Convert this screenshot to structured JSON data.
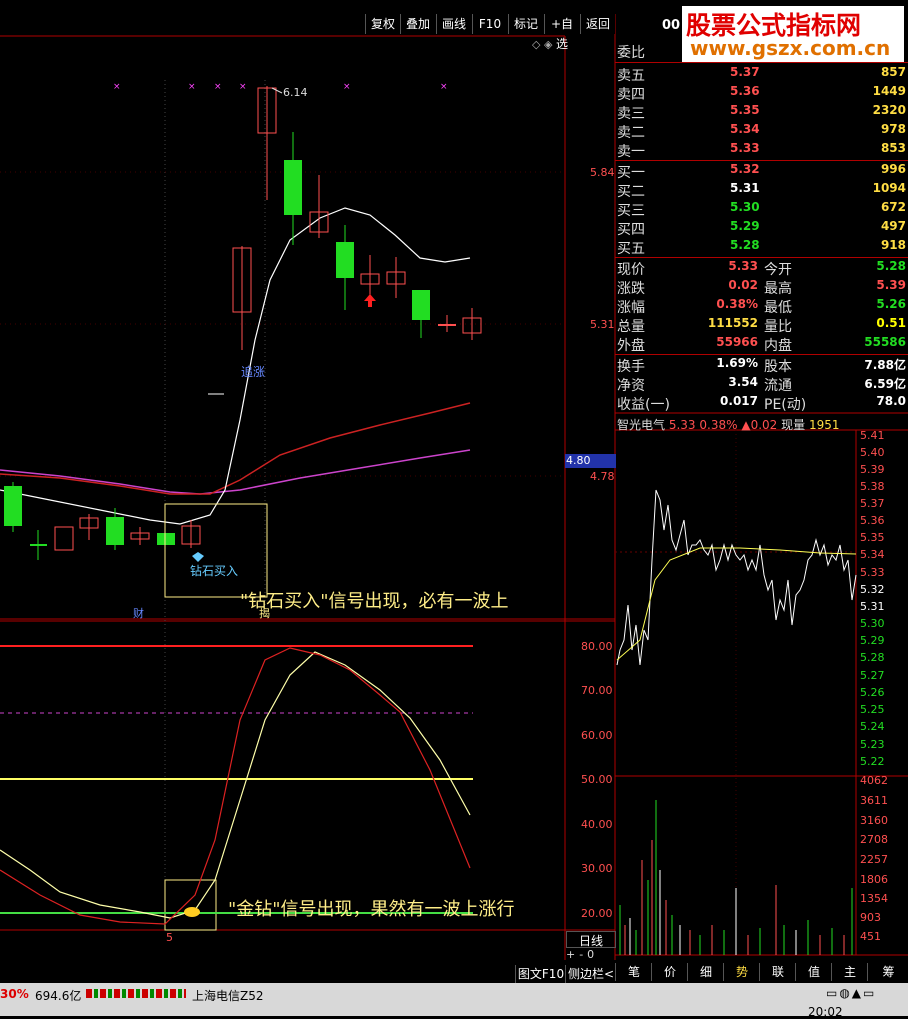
{
  "toolbar": {
    "buttons": [
      "复权",
      "叠加",
      "画线",
      "F10",
      "标记",
      "+自选",
      "返回"
    ],
    "code_prefix": "00"
  },
  "watermark": {
    "line1": "股票公式指标网",
    "line2": "www.gszx.com.cn"
  },
  "order_book": {
    "header": "委比",
    "asks": [
      {
        "label": "卖五",
        "price": "5.37",
        "vol": "857"
      },
      {
        "label": "卖四",
        "price": "5.36",
        "vol": "1449"
      },
      {
        "label": "卖三",
        "price": "5.35",
        "vol": "2320"
      },
      {
        "label": "卖二",
        "price": "5.34",
        "vol": "978"
      },
      {
        "label": "卖一",
        "price": "5.33",
        "vol": "853"
      }
    ],
    "bids": [
      {
        "label": "买一",
        "price": "5.32",
        "vol": "996"
      },
      {
        "label": "买二",
        "price": "5.31",
        "vol": "1094"
      },
      {
        "label": "买三",
        "price": "5.30",
        "vol": "672"
      },
      {
        "label": "买四",
        "price": "5.29",
        "vol": "497"
      },
      {
        "label": "买五",
        "price": "5.28",
        "vol": "918"
      }
    ]
  },
  "stats": [
    {
      "l1": "现价",
      "v1": "5.33",
      "l2": "今开",
      "v2": "5.28"
    },
    {
      "l1": "涨跌",
      "v1": "0.02",
      "l2": "最高",
      "v2": "5.39"
    },
    {
      "l1": "涨幅",
      "v1": "0.38%",
      "l2": "最低",
      "v2": "5.26"
    },
    {
      "l1": "总量",
      "v1": "111552",
      "l2": "量比",
      "v2": "0.51"
    },
    {
      "l1": "外盘",
      "v1": "55966",
      "l2": "内盘",
      "v2": "55586"
    }
  ],
  "stats2": [
    {
      "l1": "换手",
      "v1": "1.69%",
      "l2": "股本",
      "v2": "7.88亿"
    },
    {
      "l1": "净资",
      "v1": "3.54",
      "l2": "流通",
      "v2": "6.59亿"
    },
    {
      "l1": "收益(一)",
      "v1": "0.017",
      "l2": "PE(动)",
      "v2": "78.0"
    }
  ],
  "mini_header": {
    "name": "智光电气",
    "price": "5.33",
    "pct": "0.38%",
    "chg": "▲0.02",
    "vol_label": "现量",
    "vol": "1951"
  },
  "mini_price_ticks": [
    "5.41",
    "5.40",
    "5.39",
    "5.38",
    "5.37",
    "5.36",
    "5.35",
    "5.34",
    "5.33",
    "5.32",
    "5.31",
    "5.30",
    "5.29",
    "5.28",
    "5.27",
    "5.26",
    "5.25",
    "5.24",
    "5.23",
    "5.22"
  ],
  "mini_vol_ticks": [
    "4062",
    "3611",
    "3160",
    "2708",
    "2257",
    "1806",
    "1354",
    "903",
    "451"
  ],
  "main_chart": {
    "price_ticks": [
      "5.84",
      "5.31",
      "4.78"
    ],
    "high_label": "6.14",
    "current_box": "4.80",
    "annot_chase": "追涨",
    "annot_diamond": "钻石买入",
    "annot_cai": "财",
    "annot_jiu": "揭",
    "caption1": "\"钻石买入\"信号出现，必有一波上",
    "caption2": "\"金钻\"信号出现，果然有一波上涨行",
    "osc_ticks": [
      "80.00",
      "70.00",
      "60.00",
      "50.00",
      "40.00",
      "30.00",
      "20.00"
    ],
    "osc_marker": "5",
    "period": "日线"
  },
  "bottom_tabs": [
    "图文F10",
    "侧边栏<"
  ],
  "mini_tabs": [
    "笔",
    "价",
    "细",
    "势",
    "联",
    "值",
    "主",
    "筹"
  ],
  "mini_tab_active": "势",
  "status": {
    "pct": "30%",
    "amount": "694.6亿",
    "ticker": "上海电信Z52",
    "clock": "20:02"
  },
  "colors": {
    "up": "#ff5050",
    "down": "#22dd22",
    "grid": "#b00000"
  },
  "chart_data": {
    "type": "line",
    "title": "",
    "oscillator_range": [
      20,
      80
    ],
    "candle_price_range": [
      4.78,
      6.14
    ]
  }
}
